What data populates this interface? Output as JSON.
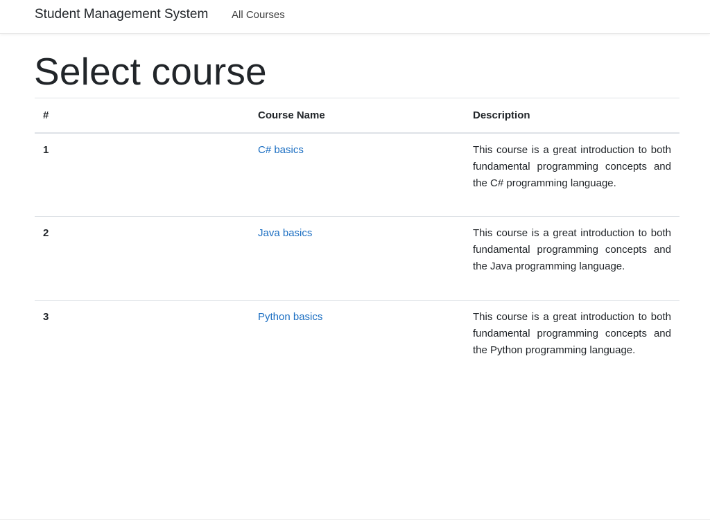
{
  "navbar": {
    "brand": "Student Management System",
    "links": [
      {
        "label": "All Courses"
      }
    ]
  },
  "main": {
    "title": "Select course",
    "table": {
      "headers": [
        "#",
        "Course Name",
        "Description"
      ],
      "rows": [
        {
          "num": "1",
          "name": "C# basics",
          "description": "This course is a great introduction to both fundamental programming concepts and the C# programming language."
        },
        {
          "num": "2",
          "name": "Java basics",
          "description": "This course is a great introduction to both fundamental programming concepts and the Java programming language."
        },
        {
          "num": "3",
          "name": "Python basics",
          "description": "This course is a great introduction to both fundamental programming concepts and the Python programming language."
        }
      ]
    }
  },
  "colors": {
    "link": "#1b6ec2",
    "text": "#212529",
    "border": "#dee2e6"
  }
}
